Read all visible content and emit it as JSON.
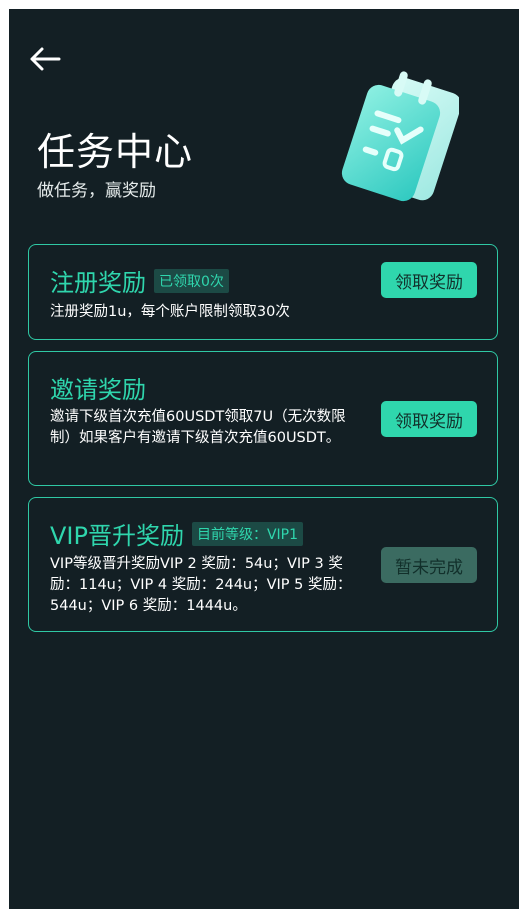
{
  "header": {
    "title": "任务中心",
    "subtitle": "做任务，赢奖励"
  },
  "tasks": [
    {
      "title": "注册奖励",
      "badge": "已领取0次",
      "description": "注册奖励1u，每个账户限制领取30次",
      "button": "领取奖励",
      "button_state": "active"
    },
    {
      "title": "邀请奖励",
      "badge": "",
      "description": "邀请下级首次充值60USDT领取7U（无次数限制）如果客户有邀请下级首次充值60USDT。",
      "button": "领取奖励",
      "button_state": "active"
    },
    {
      "title": "VIP晋升奖励",
      "badge": "目前等级：VIP1",
      "description": "VIP等级晋升奖励VIP 2 奖励：54u；VIP 3 奖励：114u；VIP 4 奖励：244u；VIP 5 奖励：544u；VIP 6 奖励：1444u。",
      "button": "暂未完成",
      "button_state": "disabled"
    }
  ],
  "colors": {
    "background": "#131f24",
    "accent": "#2fd6ad",
    "border": "#2fc8a4",
    "disabled_button": "#3b6b61"
  },
  "icons": {
    "back": "arrow-left-icon",
    "hero": "task-notepad-icon"
  }
}
